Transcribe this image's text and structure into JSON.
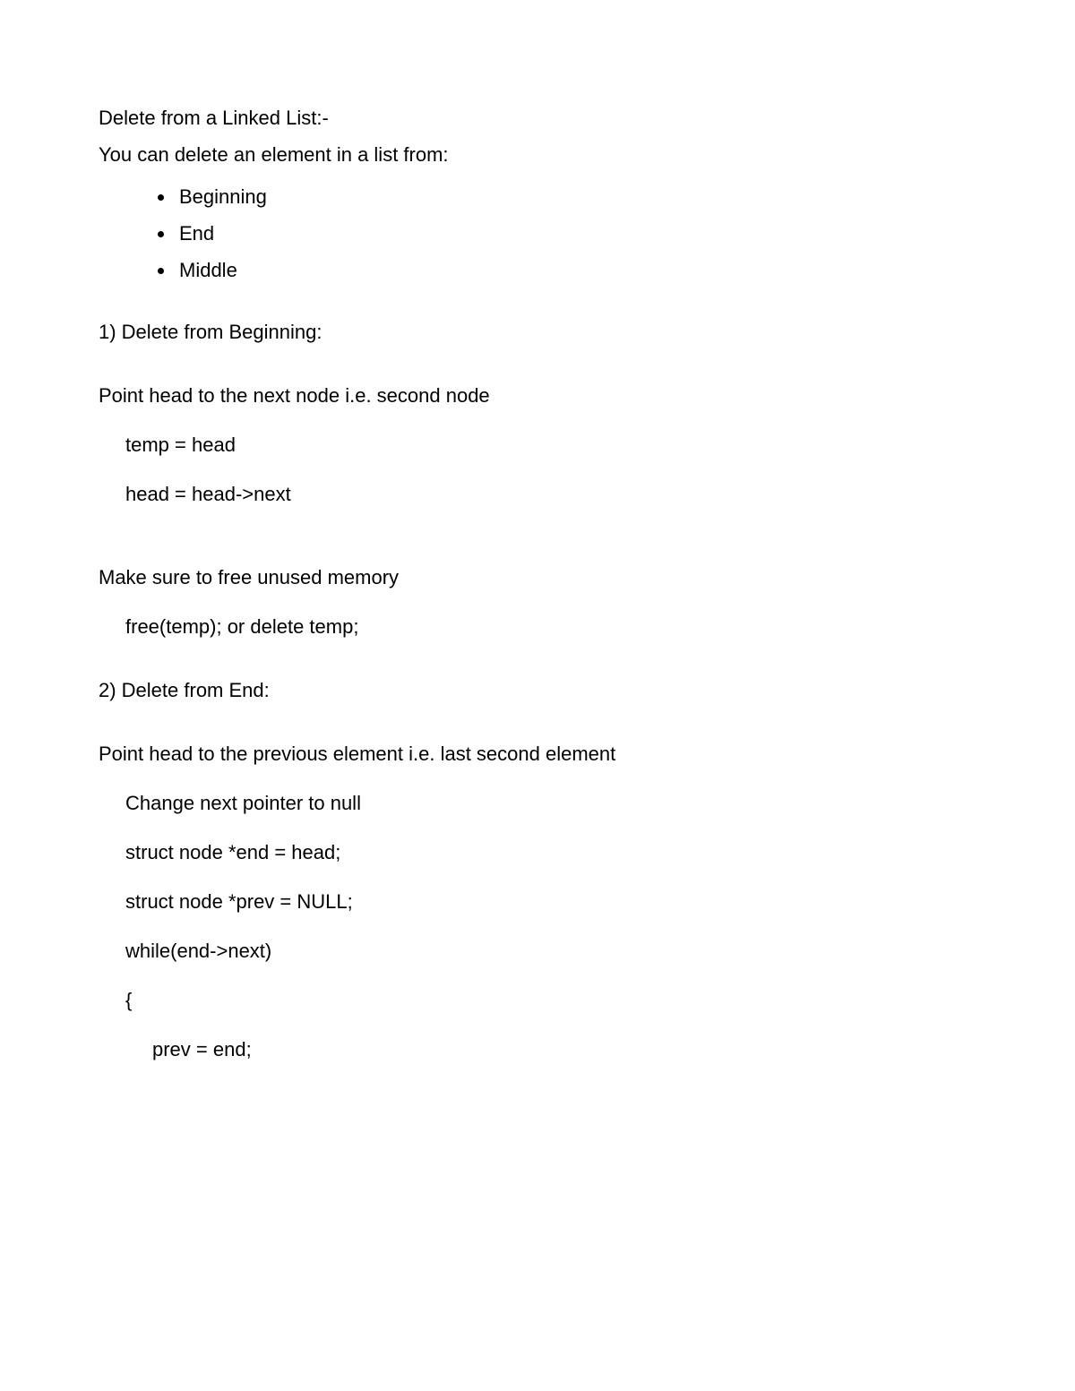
{
  "title": "Delete from a Linked List:-",
  "intro": "You can delete an element in a list from:",
  "bullets": [
    "Beginning",
    "End",
    "Middle"
  ],
  "s1": {
    "heading": "1) Delete from Beginning:",
    "desc": "Point head to the next node i.e. second node",
    "code1": "temp = head",
    "code2": "head = head->next",
    "note": "Make sure to free unused memory",
    "code3": "free(temp); or delete temp;"
  },
  "s2": {
    "heading": "2) Delete from End:",
    "desc": "Point head to the previous element i.e. last second element",
    "line1": "Change next pointer to null",
    "line2": "struct node *end = head;",
    "line3": "struct node *prev = NULL;",
    "line4": "while(end->next)",
    "line5": "{",
    "line6": "prev = end;"
  }
}
